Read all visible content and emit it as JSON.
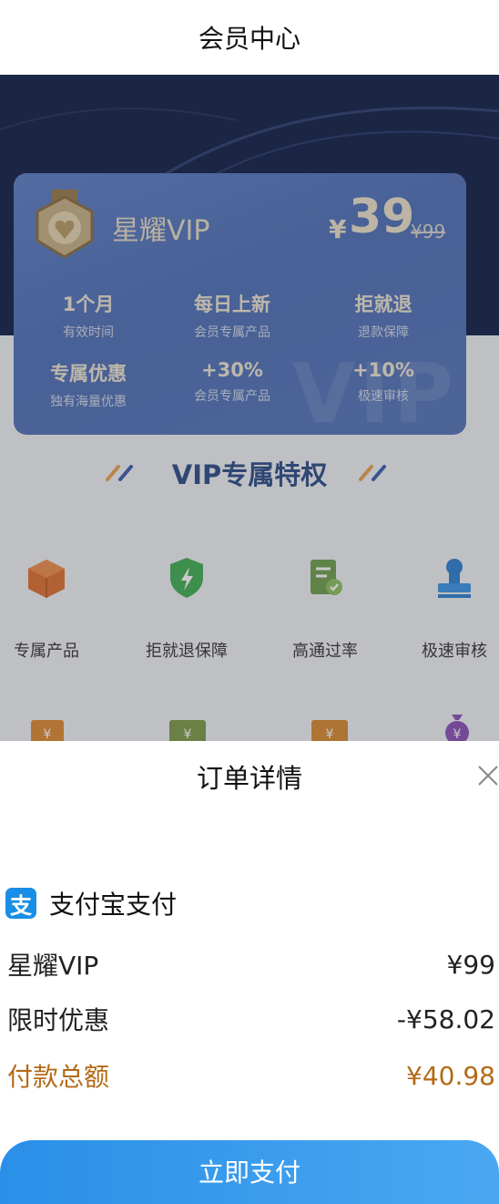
{
  "header": {
    "title": "会员中心"
  },
  "card": {
    "name": "星耀VIP",
    "price_symbol": "¥",
    "price": "39",
    "original_price": "¥99",
    "watermark": "VIP",
    "features": [
      {
        "value": "1个月",
        "desc": "有效时间"
      },
      {
        "value": "每日上新",
        "desc": "会员专属产品"
      },
      {
        "value": "拒就退",
        "desc": "退款保障"
      },
      {
        "value": "专属优惠",
        "desc": "独有海量优惠"
      },
      {
        "value": "+30%",
        "desc": "会员专属产品"
      },
      {
        "value": "+10%",
        "desc": "极速审核"
      }
    ]
  },
  "section": {
    "title": "VIP专属特权"
  },
  "privileges": [
    {
      "label": "专属产品",
      "icon": "box-icon"
    },
    {
      "label": "拒就退保障",
      "icon": "shield-icon"
    },
    {
      "label": "高通过率",
      "icon": "document-check-icon"
    },
    {
      "label": "极速审核",
      "icon": "stamp-icon"
    }
  ],
  "order": {
    "title": "订单详情",
    "payment_method": "支付宝支付",
    "alipay_glyph": "支",
    "items": [
      {
        "label": "星耀VIP",
        "value": "¥99"
      },
      {
        "label": "限时优惠",
        "value": "-¥58.02"
      },
      {
        "label": "付款总额",
        "value": "¥40.98"
      }
    ],
    "pay_button": "立即支付"
  },
  "colors": {
    "accent_blue": "#2a8fe8",
    "total_orange": "#b36a17",
    "card_blue": "#5474b8",
    "title_blue": "#2c4b86"
  }
}
